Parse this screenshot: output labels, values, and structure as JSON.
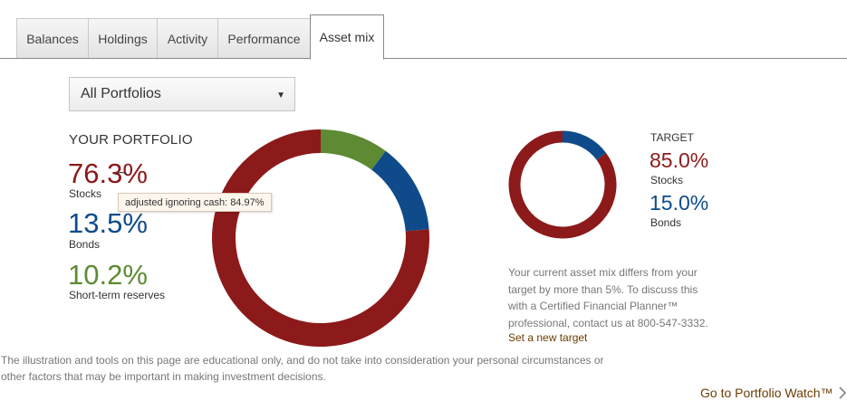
{
  "tabs": [
    {
      "label": "Balances",
      "active": false
    },
    {
      "label": "Holdings",
      "active": false
    },
    {
      "label": "Activity",
      "active": false
    },
    {
      "label": "Performance",
      "active": false
    },
    {
      "label": "Asset mix",
      "active": true
    }
  ],
  "portfolio_select": {
    "value": "All Portfolios"
  },
  "portfolio": {
    "title": "YOUR PORTFOLIO",
    "stocks": {
      "pct": "76.3%",
      "label": "Stocks",
      "value": 76.3,
      "color": "#8c1a1a"
    },
    "bonds": {
      "pct": "13.5%",
      "label": "Bonds",
      "value": 13.5,
      "color": "#0f4b8a"
    },
    "reserves": {
      "pct": "10.2%",
      "label": "Short-term reserves",
      "value": 10.2,
      "color": "#5d8a32"
    },
    "tooltip": "adjusted ignoring cash: 84.97%"
  },
  "target": {
    "title": "TARGET",
    "stocks": {
      "pct": "85.0%",
      "label": "Stocks",
      "value": 85.0,
      "color": "#8c1a1a"
    },
    "bonds": {
      "pct": "15.0%",
      "label": "Bonds",
      "value": 15.0,
      "color": "#0f4b8a"
    },
    "note": "Your current asset mix differs from your target by more than 5%. To discuss this with a Certified Financial Planner™ professional, contact us at 800-547-3332.",
    "link": "Set a new target"
  },
  "disclaimer": "The illustration and tools on this page are educational only, and do not take into consideration your personal circumstances or other factors that may be important in making investment decisions.",
  "portfolio_watch_link": "Go to Portfolio Watch™",
  "icons": {
    "dropdown": "caret-down-icon",
    "link_arrow": "chevron-right-icon",
    "cursor": "mouse-cursor-icon"
  }
}
